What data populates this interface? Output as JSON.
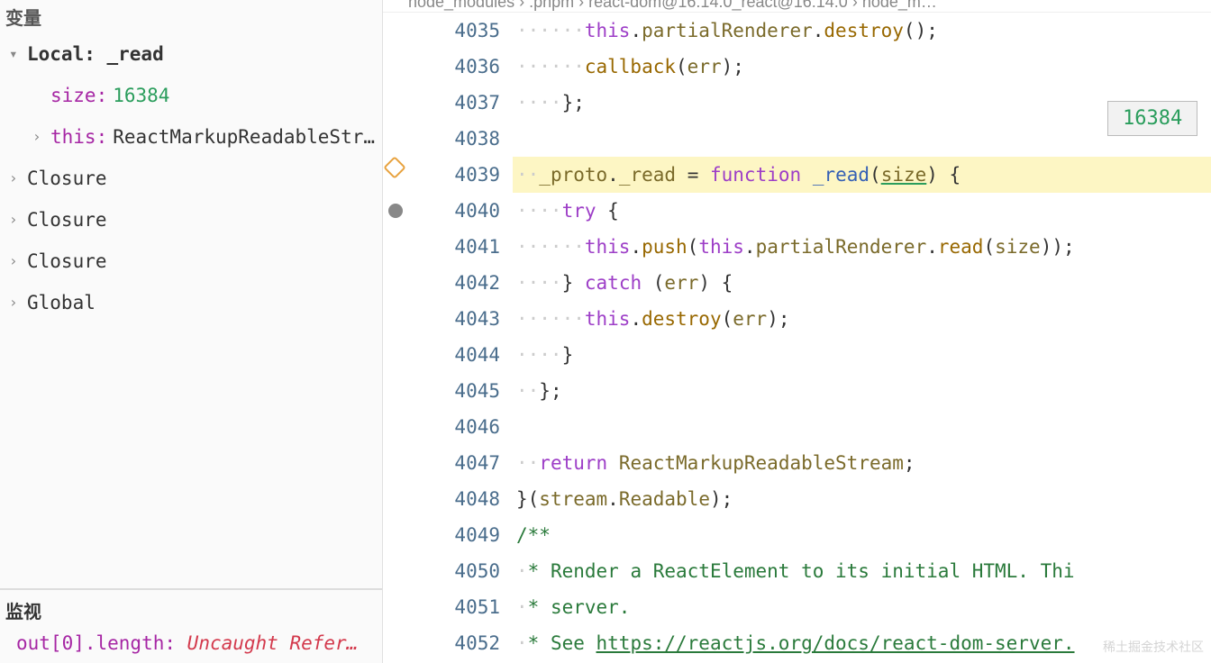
{
  "sidebar": {
    "variables_title": "变量",
    "scopes": [
      {
        "chev": "▾",
        "label": "Local: _read",
        "bold": true,
        "indent": 0
      },
      {
        "chev": "",
        "key": "size:",
        "val": "16384",
        "val_class": "v-green",
        "indent": 1
      },
      {
        "chev": "›",
        "key": "this:",
        "val": "ReactMarkupReadableStr…",
        "val_class": "plain",
        "indent": 1
      },
      {
        "chev": "›",
        "label": "Closure",
        "indent": 0
      },
      {
        "chev": "›",
        "label": "Closure",
        "indent": 0
      },
      {
        "chev": "›",
        "label": "Closure",
        "indent": 0
      },
      {
        "chev": "›",
        "label": "Global",
        "indent": 0
      }
    ],
    "watch_title": "监视",
    "watch_items": [
      {
        "key": "out[0].length:",
        "val": "Uncaught Refer…"
      }
    ]
  },
  "breadcrumb": "node_modules › .pnpm › react-dom@16.14.0_react@16.14.0 › node_m…",
  "tooltip": "16384",
  "code": {
    "lines": [
      {
        "n": 4035,
        "ws": "······",
        "html": "<span class='kw'>this</span><span class='punct'>.</span><span class='prop'>partialRenderer</span><span class='punct'>.</span><span class='fn'>destroy</span><span class='punct'>();</span>"
      },
      {
        "n": 4036,
        "ws": "······",
        "html": "<span class='fn'>callback</span><span class='punct'>(</span><span class='prop'>err</span><span class='punct'>);</span>"
      },
      {
        "n": 4037,
        "ws": "····",
        "html": "<span class='punct'>};</span>"
      },
      {
        "n": 4038,
        "ws": "",
        "html": ""
      },
      {
        "n": 4039,
        "ws": "··",
        "hl": true,
        "bp": "current",
        "html": "<span class='prop'>_proto</span><span class='punct'>.</span><span class='prop'>_read</span> <span class='punct'>=</span> <span class='kw'>function</span> <span class='def'>_read</span><span class='punct'>(</span><span class='prop underline'>size</span><span class='punct'>) {</span>"
      },
      {
        "n": 4040,
        "ws": "····",
        "bp": "dot",
        "html": "<span class='kw'>try</span> <span class='punct'>{</span>"
      },
      {
        "n": 4041,
        "ws": "······",
        "html": "<span class='kw'>this</span><span class='punct'>.</span><span class='fn'>push</span><span class='punct'>(</span><span class='kw'>this</span><span class='punct'>.</span><span class='prop'>partialRenderer</span><span class='punct'>.</span><span class='fn'>read</span><span class='punct'>(</span><span class='prop'>size</span><span class='punct'>));</span>"
      },
      {
        "n": 4042,
        "ws": "····",
        "html": "<span class='punct'>}</span> <span class='kw'>catch</span> <span class='punct'>(</span><span class='prop'>err</span><span class='punct'>) {</span>"
      },
      {
        "n": 4043,
        "ws": "······",
        "html": "<span class='kw'>this</span><span class='punct'>.</span><span class='fn'>destroy</span><span class='punct'>(</span><span class='prop'>err</span><span class='punct'>);</span>"
      },
      {
        "n": 4044,
        "ws": "····",
        "html": "<span class='punct'>}</span>"
      },
      {
        "n": 4045,
        "ws": "··",
        "html": "<span class='punct'>};</span>"
      },
      {
        "n": 4046,
        "ws": "",
        "html": ""
      },
      {
        "n": 4047,
        "ws": "··",
        "html": "<span class='kw'>return</span> <span class='prop'>ReactMarkupReadableStream</span><span class='punct'>;</span>"
      },
      {
        "n": 4048,
        "ws": "",
        "html": "<span class='punct'>}(</span><span class='prop'>stream</span><span class='punct'>.</span><span class='prop'>Readable</span><span class='punct'>);</span>"
      },
      {
        "n": 4049,
        "ws": "",
        "html": "<span class='cmt'>/**</span>"
      },
      {
        "n": 4050,
        "ws": "·",
        "html": "<span class='cmt'>* Render a ReactElement to its initial HTML. Thi</span>"
      },
      {
        "n": 4051,
        "ws": "·",
        "html": "<span class='cmt'>* server.</span>"
      },
      {
        "n": 4052,
        "ws": "·",
        "html": "<span class='cmt'>* See </span><span class='url'>https://reactjs.org/docs/react-dom-server.</span>"
      }
    ]
  },
  "watermark": "稀土掘金技术社区"
}
